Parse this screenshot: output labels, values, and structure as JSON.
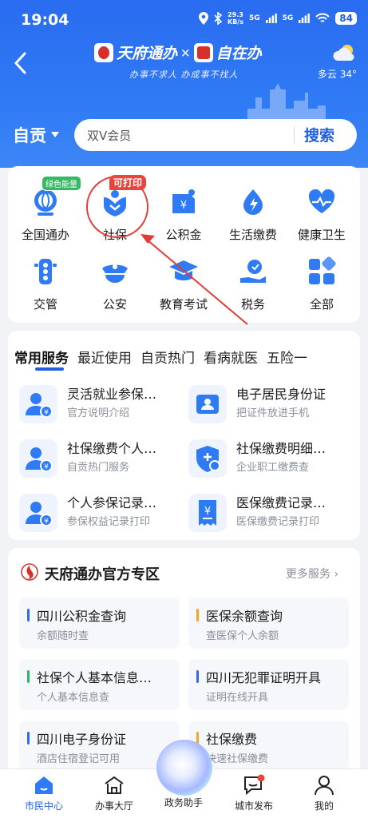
{
  "status_bar": {
    "time": "19:04",
    "net_speed_top": "29.3",
    "net_speed_unit": "KB/s",
    "signal_a": "5G",
    "signal_b": "5G",
    "battery": "84"
  },
  "header": {
    "brand_left": "天府通办",
    "brand_cross": "×",
    "brand_right": "自在办",
    "slogan": "办事不求人  办成事不找人",
    "weather": "多云 34°"
  },
  "search": {
    "city": "自贡",
    "placeholder": "双V会员",
    "button": "搜索"
  },
  "grid": {
    "items": [
      {
        "label": "全国通办",
        "tag": "绿色能量",
        "icon": "globe-icon"
      },
      {
        "label": "社保",
        "tag": "可打印",
        "icon": "social-security-icon"
      },
      {
        "label": "公积金",
        "icon": "housing-fund-icon"
      },
      {
        "label": "生活缴费",
        "icon": "utility-bill-icon"
      },
      {
        "label": "健康卫生",
        "icon": "health-heart-icon"
      },
      {
        "label": "交管",
        "icon": "traffic-light-icon"
      },
      {
        "label": "公安",
        "icon": "police-cap-icon"
      },
      {
        "label": "教育考试",
        "icon": "graduation-cap-icon"
      },
      {
        "label": "税务",
        "icon": "tax-hand-icon"
      },
      {
        "label": "全部",
        "icon": "all-apps-icon"
      }
    ]
  },
  "services": {
    "tabs": [
      "常用服务",
      "最近使用",
      "自贡热门",
      "看病就医",
      "五险一"
    ],
    "items": [
      {
        "title": "灵活就业参保…",
        "sub": "官方说明介绍",
        "icon": "person-yuan-icon"
      },
      {
        "title": "电子居民身份证",
        "sub": "把证件放进手机",
        "icon": "id-card-icon"
      },
      {
        "title": "社保缴费个人…",
        "sub": "自贡热门服务",
        "icon": "person-yuan-icon"
      },
      {
        "title": "社保缴费明细…",
        "sub": "企业职工缴费查",
        "icon": "shield-person-icon"
      },
      {
        "title": "个人参保记录…",
        "sub": "参保权益记录打印",
        "icon": "person-yuan-icon"
      },
      {
        "title": "医保缴费记录…",
        "sub": "医保缴费记录打印",
        "icon": "receipt-yuan-icon"
      }
    ]
  },
  "zone": {
    "title": "天府通办官方专区",
    "more": "更多服务",
    "items": [
      {
        "title": "四川公积金查询",
        "sub": "余额随时查",
        "color": "#2f6bea"
      },
      {
        "title": "医保余额查询",
        "sub": "查医保个人余额",
        "color": "#f0a52a"
      },
      {
        "title": "社保个人基本信息…",
        "sub": "个人基本信息查",
        "color": "#2fb56b"
      },
      {
        "title": "四川无犯罪证明开具",
        "sub": "证明在线开具",
        "color": "#2f6bea"
      },
      {
        "title": "四川电子身份证",
        "sub": "酒店住宿登记可用",
        "color": "#2f6bea"
      },
      {
        "title": "社保缴费",
        "sub": "快速社保缴费",
        "color": "#f0a52a"
      }
    ]
  },
  "bottom_nav": {
    "items": [
      {
        "label": "市民中心",
        "icon": "home-icon",
        "active": true
      },
      {
        "label": "办事大厅",
        "icon": "hall-icon"
      },
      {
        "label": "政务助手",
        "icon": "assistant-orb-icon"
      },
      {
        "label": "城市发布",
        "icon": "message-icon"
      },
      {
        "label": "我的",
        "icon": "user-icon"
      }
    ]
  },
  "colors": {
    "primary": "#1f5fe0",
    "header": "#2f7af5",
    "red": "#e23b35",
    "green_tag": "#34b964"
  }
}
